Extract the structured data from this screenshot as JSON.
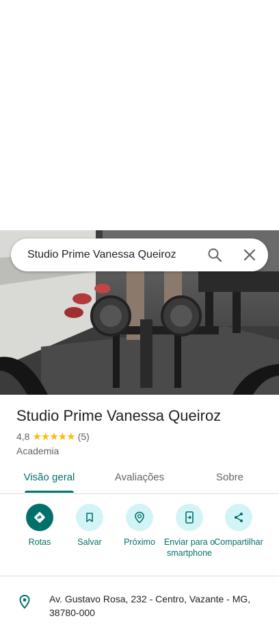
{
  "search": {
    "query": "Studio Prime Vanessa Queiroz"
  },
  "place": {
    "name": "Studio Prime Vanessa Queiroz",
    "rating": "4,8",
    "stars": "★★★★★",
    "review_count": "(5)",
    "category": "Academia"
  },
  "tabs": [
    {
      "label": "Visão geral",
      "active": true
    },
    {
      "label": "Avaliações",
      "active": false
    },
    {
      "label": "Sobre",
      "active": false
    }
  ],
  "actions": [
    {
      "label": "Rotas",
      "icon": "directions-icon"
    },
    {
      "label": "Salvar",
      "icon": "bookmark-icon"
    },
    {
      "label": "Próximo",
      "icon": "nearby-icon"
    },
    {
      "label": "Enviar para o smartphone",
      "icon": "send-to-phone-icon"
    },
    {
      "label": "Compartilhar",
      "icon": "share-icon"
    }
  ],
  "address": {
    "text": "Av. Gustavo Rosa, 232 - Centro, Vazante - MG, 38780-000",
    "icon": "location-pin-icon"
  },
  "colors": {
    "accent": "#00706a",
    "chip": "#d2f4f6",
    "star": "#fbbc04"
  }
}
